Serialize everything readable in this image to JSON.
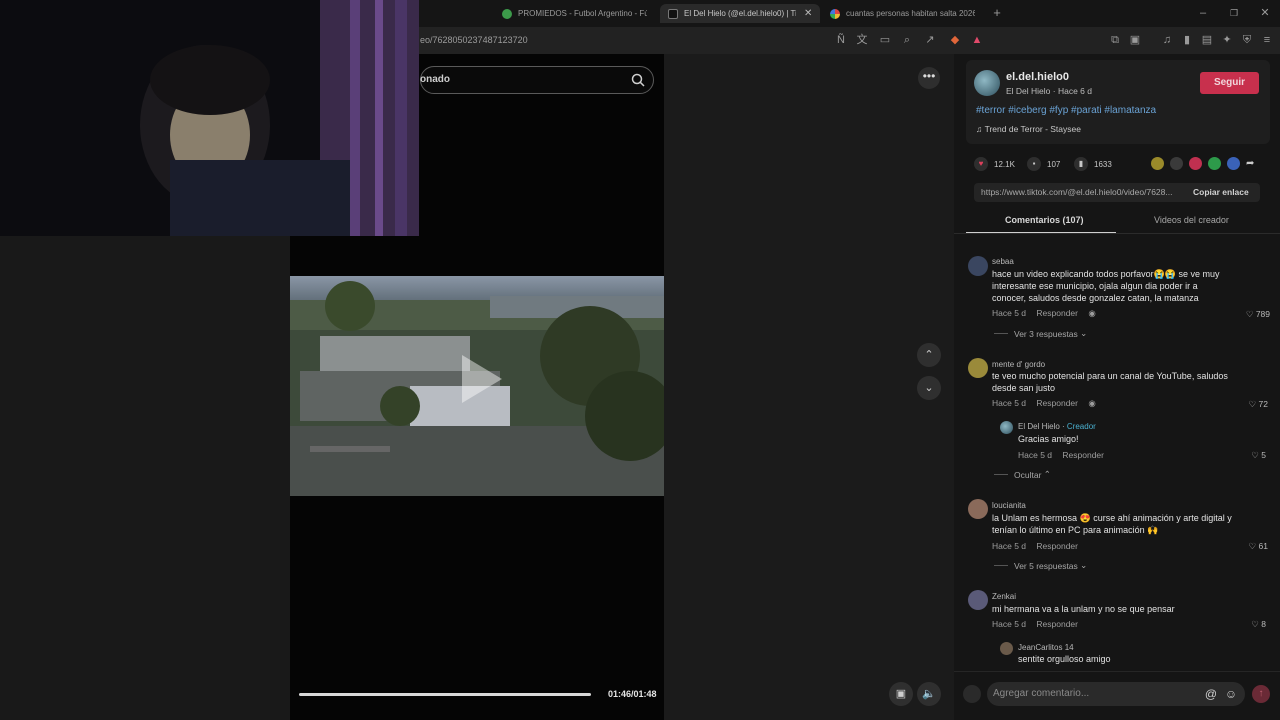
{
  "browser": {
    "tabs": [
      {
        "title": "PROMIEDOS - Futbol Argentino - Fút",
        "icon": "promiedos-favicon"
      },
      {
        "title": "El Del Hielo (@el.del.hielo0) | Tik",
        "icon": "tiktok-favicon",
        "active": true
      },
      {
        "title": "cuantas personas habitan salta 2026",
        "icon": "google-favicon"
      }
    ],
    "url": "eo/7628050237487123720"
  },
  "search": {
    "text": "onado"
  },
  "player": {
    "timecode": "01:46/01:48",
    "progress": 0.98
  },
  "creator": {
    "username": "el.del.hielo0",
    "meta": "El Del Hielo · Hace 6 d",
    "follow_label": "Seguir",
    "hashtags": "#terror #iceberg #fyp #parati #lamatanza",
    "sound": "Trend de Terror - Staysee"
  },
  "stats": {
    "likes": "12.1K",
    "comments": "107",
    "saves": "1633"
  },
  "link": {
    "url": "https://www.tiktok.com/@el.del.hielo0/video/7628...",
    "copy_label": "Copiar enlace"
  },
  "tabs": {
    "comments": "Comentarios (107)",
    "videos": "Videos del creador"
  },
  "comments": [
    {
      "user": "sebaa",
      "text": "hace un video explicando todos porfavor😭😭 se ve muy interesante ese municipio, ojala algun dia poder ir a conocer, saludos desde gonzalez catan, la matanza",
      "time": "Hace 5 d",
      "reply": "Responder",
      "likes": "789",
      "more": "Ver 3 respuestas"
    },
    {
      "user": "mente d' gordo",
      "text": "te veo mucho potencial para un canal de YouTube, saludos desde san justo",
      "time": "Hace 5 d",
      "reply": "Responder",
      "likes": "72",
      "more": "Ocultar",
      "replies": [
        {
          "user": "El Del Hielo",
          "tag": "Creador",
          "text": "Gracias amigo!",
          "time": "Hace 5 d",
          "reply": "Responder",
          "likes": "5"
        }
      ]
    },
    {
      "user": "loucianita",
      "text": "la Unlam es hermosa 😍 curse ahí animación y arte digital y tenían lo último en PC para animación 🙌",
      "time": "Hace 5 d",
      "reply": "Responder",
      "likes": "61",
      "more": "Ver 5 respuestas"
    },
    {
      "user": "Zenkai",
      "text": "mi hermana va a la unlam y no se que pensar",
      "time": "Hace 5 d",
      "reply": "Responder",
      "likes": "8",
      "replies": [
        {
          "user": "JeanCarlitos 14",
          "text": "sentite orgulloso amigo"
        }
      ]
    }
  ],
  "compose": {
    "placeholder": "Agregar comentario..."
  },
  "colors": {
    "accent": "#c8304d",
    "hashtag": "#6aa2d4",
    "creator_tag": "#4ab0cf"
  }
}
